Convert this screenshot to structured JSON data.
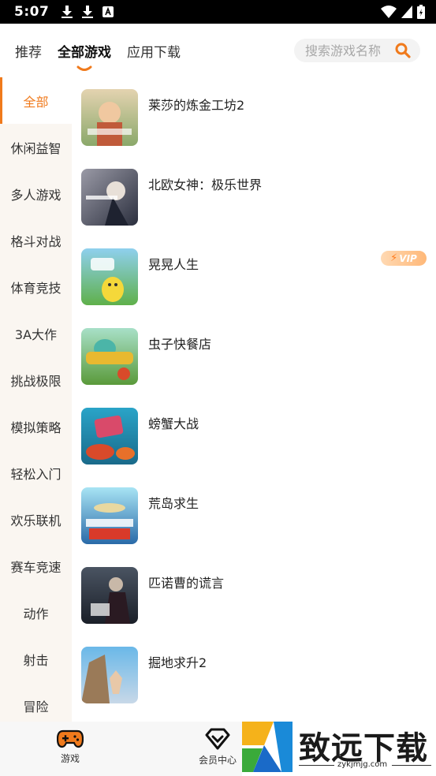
{
  "status_bar": {
    "time": "5:07",
    "icons": [
      "download-icon",
      "download-icon",
      "font-a-icon",
      "wifi-icon",
      "signal-icon",
      "battery-icon"
    ]
  },
  "top_nav": {
    "tabs": [
      {
        "label": "推荐",
        "active": false
      },
      {
        "label": "全部游戏",
        "active": true
      },
      {
        "label": "应用下载",
        "active": false
      }
    ],
    "search_placeholder": "搜索游戏名称"
  },
  "sidebar": {
    "items": [
      {
        "label": "全部",
        "active": true
      },
      {
        "label": "休闲益智"
      },
      {
        "label": "多人游戏"
      },
      {
        "label": "格斗对战"
      },
      {
        "label": "体育竞技"
      },
      {
        "label": "3A大作"
      },
      {
        "label": "挑战极限"
      },
      {
        "label": "模拟策略"
      },
      {
        "label": "轻松入门"
      },
      {
        "label": "欢乐联机"
      },
      {
        "label": "赛车竞速"
      },
      {
        "label": "动作"
      },
      {
        "label": "射击"
      },
      {
        "label": "冒险"
      }
    ]
  },
  "games": [
    {
      "name": "莱莎的炼金工坊2",
      "vip": false,
      "thumb_colors": [
        "#d9c4a0",
        "#8aa86a"
      ]
    },
    {
      "name": "北欧女神：极乐世界",
      "vip": false,
      "thumb_colors": [
        "#3b3f52",
        "#9a9aa6"
      ]
    },
    {
      "name": "晃晃人生",
      "vip": true,
      "vip_label": "VIP",
      "thumb_colors": [
        "#7fc6e8",
        "#5fb04a"
      ]
    },
    {
      "name": "虫子快餐店",
      "vip": false,
      "thumb_colors": [
        "#4bb5a8",
        "#e8b930"
      ]
    },
    {
      "name": "螃蟹大战",
      "vip": false,
      "thumb_colors": [
        "#2aa4c8",
        "#d94a2a"
      ]
    },
    {
      "name": "荒岛求生",
      "vip": false,
      "thumb_colors": [
        "#7fd0e8",
        "#2a6aa8"
      ]
    },
    {
      "name": "匹诺曹的谎言",
      "vip": false,
      "thumb_colors": [
        "#3a4452",
        "#1f2630"
      ]
    },
    {
      "name": "掘地求升2",
      "vip": false,
      "thumb_colors": [
        "#4aa0d8",
        "#b08050"
      ]
    }
  ],
  "bottom_nav": {
    "items": [
      {
        "label": "游戏",
        "icon": "gamepad-icon"
      },
      {
        "label": "会员中心",
        "icon": "diamond-icon"
      }
    ]
  },
  "watermark": {
    "title": "致远下载",
    "url": "zykjmjg.com"
  },
  "colors": {
    "accent": "#f07a1c",
    "sidebar_bg": "#faf6f1"
  }
}
